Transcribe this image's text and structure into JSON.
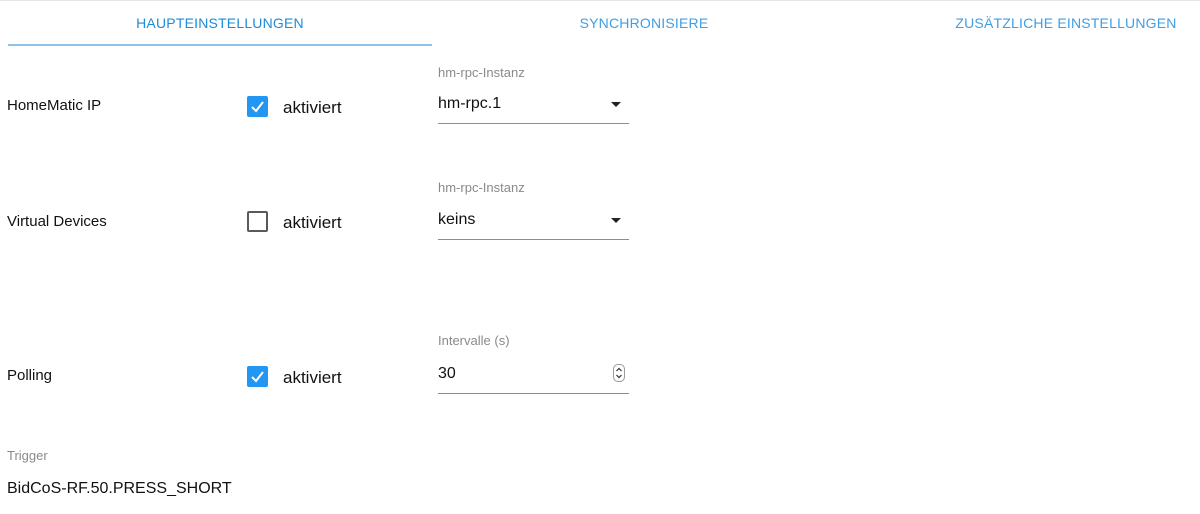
{
  "tabs": {
    "main": "HAUPTEINSTELLUNGEN",
    "sync": "SYNCHRONISIERE",
    "extra": "ZUSÄTZLICHE EINSTELLUNGEN",
    "active": "main"
  },
  "colors": {
    "accent": "#2196f3",
    "tab_text": "#3f9ee3",
    "tab_indicator": "#8ec3ea"
  },
  "homematic_ip": {
    "label": "HomeMatic IP",
    "checked": true,
    "checkbox_label": "aktiviert",
    "field_label": "hm-rpc-Instanz",
    "field_value": "hm-rpc.1"
  },
  "virtual_devices": {
    "label": "Virtual Devices",
    "checked": false,
    "checkbox_label": "aktiviert",
    "field_label": "hm-rpc-Instanz",
    "field_value": "keins"
  },
  "polling": {
    "label": "Polling",
    "checked": true,
    "checkbox_label": "aktiviert",
    "field_label": "Intervalle (s)",
    "field_value": "30"
  },
  "trigger": {
    "label": "Trigger",
    "value": "BidCoS-RF.50.PRESS_SHORT"
  },
  "icons": {
    "dropdown": "triangle-down-icon",
    "checkmark": "checkmark-icon",
    "stepper": "up-down-stepper-icon"
  }
}
